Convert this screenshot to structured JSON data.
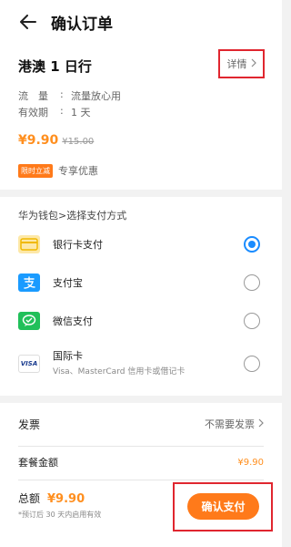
{
  "header": {
    "title": "确认订单"
  },
  "product": {
    "name": "港澳 1 日行",
    "detail_label": "详情",
    "info": [
      {
        "key": "流　量",
        "sep": ":",
        "value": "流量放心用"
      },
      {
        "key": "有效期",
        "sep": ":",
        "value": "1 天"
      }
    ],
    "price": "¥9.90",
    "original_price": "¥15.00",
    "promo_badge": "限时立减",
    "promo_text": "专享优惠"
  },
  "payment": {
    "section_label": "华为钱包>选择支付方式",
    "methods": [
      {
        "label": "银行卡支付",
        "sub": "",
        "icon": "bank-card-icon",
        "selected": true
      },
      {
        "label": "支付宝",
        "sub": "",
        "icon": "alipay-icon",
        "selected": false
      },
      {
        "label": "微信支付",
        "sub": "",
        "icon": "wechat-pay-icon",
        "selected": false
      },
      {
        "label": "国际卡",
        "sub": "Visa、MasterCard 信用卡或借记卡",
        "icon": "visa-icon",
        "selected": false
      }
    ],
    "visa_text": "VISA"
  },
  "footer": {
    "invoice_label": "发票",
    "invoice_value": "不需要发票",
    "package_label": "套餐金额",
    "package_value": "¥9.90",
    "total_label": "总额",
    "total_value": "¥9.90",
    "note": "*预订后 30 天内启用有效",
    "pay_button": "确认支付"
  },
  "colors": {
    "accent": "#ff7a1a",
    "price": "#ff8f1f",
    "highlight_box": "#e0262f",
    "radio_selected": "#1a8cff"
  }
}
